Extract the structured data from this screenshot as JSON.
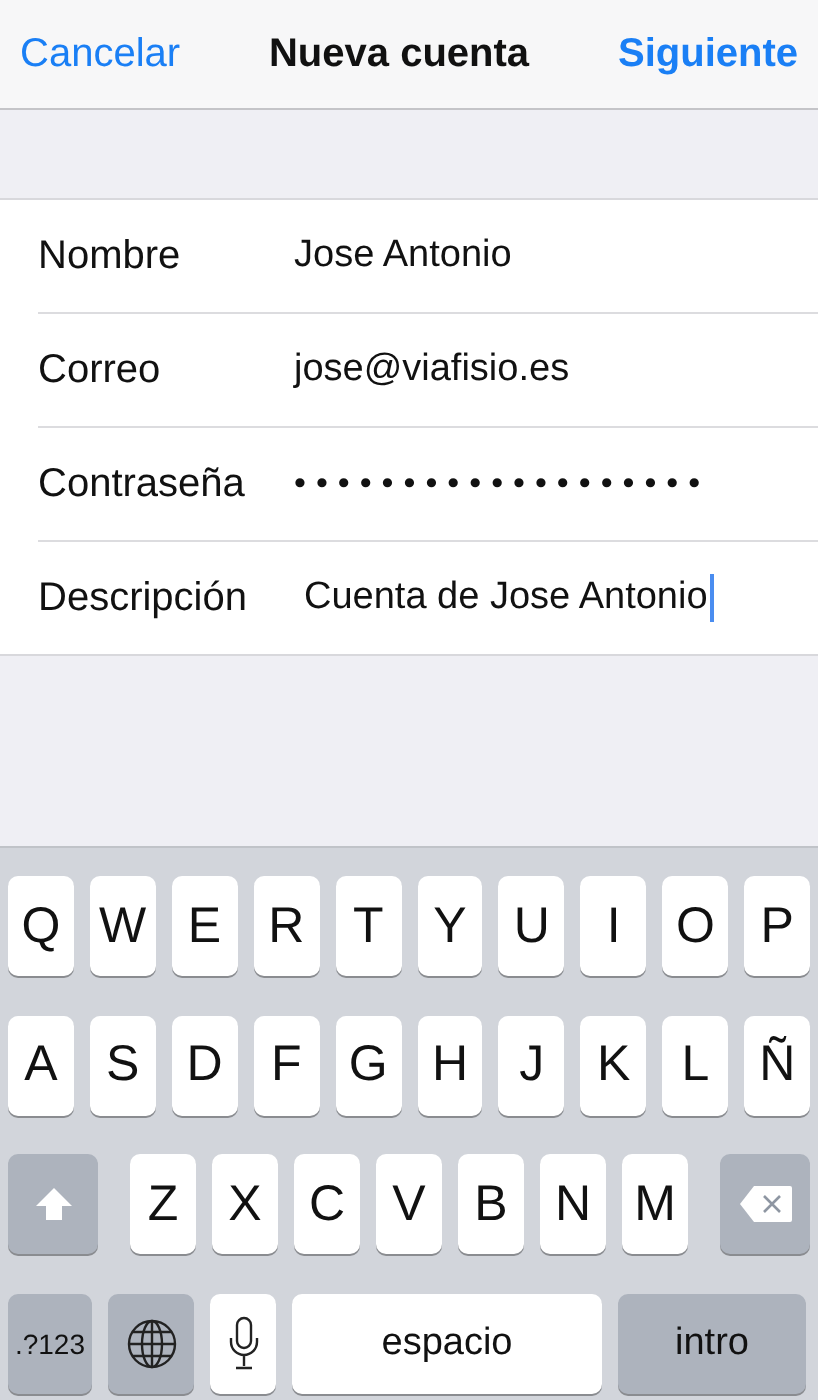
{
  "nav_bar": {
    "left_button": "Cancelar",
    "title": "Nueva cuenta",
    "right_button": "Siguiente"
  },
  "form": [
    {
      "label": "Nombre",
      "value": "Jose Antonio",
      "focused": false
    },
    {
      "label": "Correo",
      "value": "jose@viafisio.es",
      "focused": false
    },
    {
      "label": "Contraseña",
      "value": "•••••••••••••••••••",
      "focused": false
    },
    {
      "label": "Descripción",
      "value": "Cuenta de Jose Antonio",
      "focused": true
    }
  ],
  "keyboard": {
    "top_row": [
      {
        "kind": "letter",
        "label": "Q"
      },
      {
        "kind": "letter",
        "label": "W"
      },
      {
        "kind": "letter",
        "label": "E"
      },
      {
        "kind": "letter",
        "label": "R"
      },
      {
        "kind": "letter",
        "label": "T"
      },
      {
        "kind": "letter",
        "label": "Y"
      },
      {
        "kind": "letter",
        "label": "U"
      },
      {
        "kind": "letter",
        "label": "I"
      },
      {
        "kind": "letter",
        "label": "O"
      },
      {
        "kind": "letter",
        "label": "P"
      }
    ],
    "middle_row": [
      {
        "kind": "letter",
        "label": "A"
      },
      {
        "kind": "letter",
        "label": "S"
      },
      {
        "kind": "letter",
        "label": "D"
      },
      {
        "kind": "letter",
        "label": "F"
      },
      {
        "kind": "letter",
        "label": "G"
      },
      {
        "kind": "letter",
        "label": "H"
      },
      {
        "kind": "letter",
        "label": "J"
      },
      {
        "kind": "letter",
        "label": "K"
      },
      {
        "kind": "letter",
        "label": "L"
      },
      {
        "kind": "letter",
        "label": "Ñ"
      }
    ],
    "bottom_row": [
      {
        "kind": "shift"
      },
      {
        "kind": "letter",
        "label": "Z"
      },
      {
        "kind": "letter",
        "label": "X"
      },
      {
        "kind": "letter",
        "label": "C"
      },
      {
        "kind": "letter",
        "label": "V"
      },
      {
        "kind": "letter",
        "label": "B"
      },
      {
        "kind": "letter",
        "label": "N"
      },
      {
        "kind": "letter",
        "label": "M"
      },
      {
        "kind": "delete"
      }
    ],
    "function_row": [
      {
        "kind": "mode",
        "label": ".?123"
      },
      {
        "kind": "globe"
      },
      {
        "kind": "mic"
      },
      {
        "kind": "space",
        "label": "espacio"
      },
      {
        "kind": "return",
        "label": "intro"
      }
    ]
  }
}
